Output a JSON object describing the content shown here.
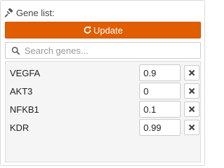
{
  "header": {
    "title": "Gene list:",
    "icon": "gavel-icon"
  },
  "update_button": {
    "label": "Update",
    "icon": "refresh-icon",
    "color": "#e05e00"
  },
  "search": {
    "placeholder": "Search genes...",
    "value": "",
    "icon": "search-icon"
  },
  "genes": [
    {
      "name": "VEGFA",
      "value": "0.9"
    },
    {
      "name": "AKT3",
      "value": "0"
    },
    {
      "name": "NFKB1",
      "value": "0.1"
    },
    {
      "name": "KDR",
      "value": "0.99"
    }
  ],
  "remove_icon": "close-icon"
}
